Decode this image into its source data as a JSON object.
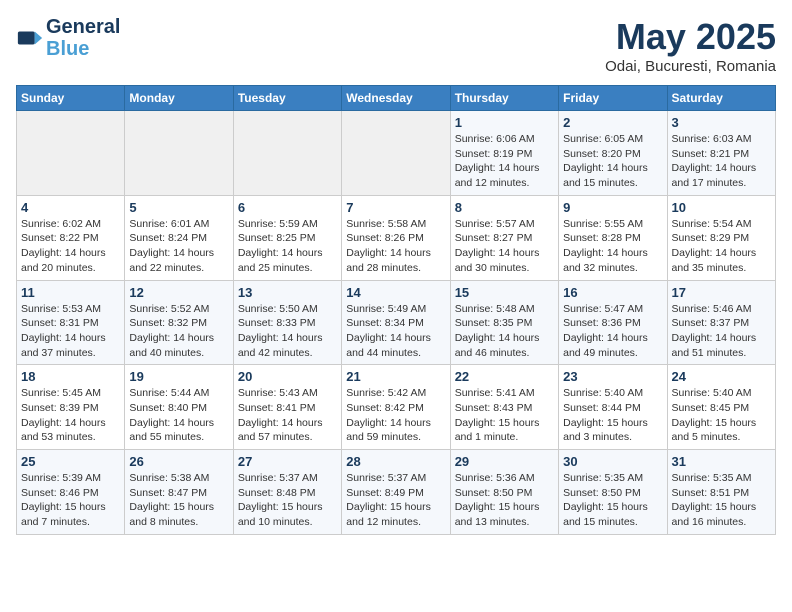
{
  "header": {
    "logo_line1": "General",
    "logo_line2": "Blue",
    "month_title": "May 2025",
    "subtitle": "Odai, Bucuresti, Romania"
  },
  "weekdays": [
    "Sunday",
    "Monday",
    "Tuesday",
    "Wednesday",
    "Thursday",
    "Friday",
    "Saturday"
  ],
  "weeks": [
    [
      {
        "day": "",
        "info": ""
      },
      {
        "day": "",
        "info": ""
      },
      {
        "day": "",
        "info": ""
      },
      {
        "day": "",
        "info": ""
      },
      {
        "day": "1",
        "info": "Sunrise: 6:06 AM\nSunset: 8:19 PM\nDaylight: 14 hours\nand 12 minutes."
      },
      {
        "day": "2",
        "info": "Sunrise: 6:05 AM\nSunset: 8:20 PM\nDaylight: 14 hours\nand 15 minutes."
      },
      {
        "day": "3",
        "info": "Sunrise: 6:03 AM\nSunset: 8:21 PM\nDaylight: 14 hours\nand 17 minutes."
      }
    ],
    [
      {
        "day": "4",
        "info": "Sunrise: 6:02 AM\nSunset: 8:22 PM\nDaylight: 14 hours\nand 20 minutes."
      },
      {
        "day": "5",
        "info": "Sunrise: 6:01 AM\nSunset: 8:24 PM\nDaylight: 14 hours\nand 22 minutes."
      },
      {
        "day": "6",
        "info": "Sunrise: 5:59 AM\nSunset: 8:25 PM\nDaylight: 14 hours\nand 25 minutes."
      },
      {
        "day": "7",
        "info": "Sunrise: 5:58 AM\nSunset: 8:26 PM\nDaylight: 14 hours\nand 28 minutes."
      },
      {
        "day": "8",
        "info": "Sunrise: 5:57 AM\nSunset: 8:27 PM\nDaylight: 14 hours\nand 30 minutes."
      },
      {
        "day": "9",
        "info": "Sunrise: 5:55 AM\nSunset: 8:28 PM\nDaylight: 14 hours\nand 32 minutes."
      },
      {
        "day": "10",
        "info": "Sunrise: 5:54 AM\nSunset: 8:29 PM\nDaylight: 14 hours\nand 35 minutes."
      }
    ],
    [
      {
        "day": "11",
        "info": "Sunrise: 5:53 AM\nSunset: 8:31 PM\nDaylight: 14 hours\nand 37 minutes."
      },
      {
        "day": "12",
        "info": "Sunrise: 5:52 AM\nSunset: 8:32 PM\nDaylight: 14 hours\nand 40 minutes."
      },
      {
        "day": "13",
        "info": "Sunrise: 5:50 AM\nSunset: 8:33 PM\nDaylight: 14 hours\nand 42 minutes."
      },
      {
        "day": "14",
        "info": "Sunrise: 5:49 AM\nSunset: 8:34 PM\nDaylight: 14 hours\nand 44 minutes."
      },
      {
        "day": "15",
        "info": "Sunrise: 5:48 AM\nSunset: 8:35 PM\nDaylight: 14 hours\nand 46 minutes."
      },
      {
        "day": "16",
        "info": "Sunrise: 5:47 AM\nSunset: 8:36 PM\nDaylight: 14 hours\nand 49 minutes."
      },
      {
        "day": "17",
        "info": "Sunrise: 5:46 AM\nSunset: 8:37 PM\nDaylight: 14 hours\nand 51 minutes."
      }
    ],
    [
      {
        "day": "18",
        "info": "Sunrise: 5:45 AM\nSunset: 8:39 PM\nDaylight: 14 hours\nand 53 minutes."
      },
      {
        "day": "19",
        "info": "Sunrise: 5:44 AM\nSunset: 8:40 PM\nDaylight: 14 hours\nand 55 minutes."
      },
      {
        "day": "20",
        "info": "Sunrise: 5:43 AM\nSunset: 8:41 PM\nDaylight: 14 hours\nand 57 minutes."
      },
      {
        "day": "21",
        "info": "Sunrise: 5:42 AM\nSunset: 8:42 PM\nDaylight: 14 hours\nand 59 minutes."
      },
      {
        "day": "22",
        "info": "Sunrise: 5:41 AM\nSunset: 8:43 PM\nDaylight: 15 hours\nand 1 minute."
      },
      {
        "day": "23",
        "info": "Sunrise: 5:40 AM\nSunset: 8:44 PM\nDaylight: 15 hours\nand 3 minutes."
      },
      {
        "day": "24",
        "info": "Sunrise: 5:40 AM\nSunset: 8:45 PM\nDaylight: 15 hours\nand 5 minutes."
      }
    ],
    [
      {
        "day": "25",
        "info": "Sunrise: 5:39 AM\nSunset: 8:46 PM\nDaylight: 15 hours\nand 7 minutes."
      },
      {
        "day": "26",
        "info": "Sunrise: 5:38 AM\nSunset: 8:47 PM\nDaylight: 15 hours\nand 8 minutes."
      },
      {
        "day": "27",
        "info": "Sunrise: 5:37 AM\nSunset: 8:48 PM\nDaylight: 15 hours\nand 10 minutes."
      },
      {
        "day": "28",
        "info": "Sunrise: 5:37 AM\nSunset: 8:49 PM\nDaylight: 15 hours\nand 12 minutes."
      },
      {
        "day": "29",
        "info": "Sunrise: 5:36 AM\nSunset: 8:50 PM\nDaylight: 15 hours\nand 13 minutes."
      },
      {
        "day": "30",
        "info": "Sunrise: 5:35 AM\nSunset: 8:50 PM\nDaylight: 15 hours\nand 15 minutes."
      },
      {
        "day": "31",
        "info": "Sunrise: 5:35 AM\nSunset: 8:51 PM\nDaylight: 15 hours\nand 16 minutes."
      }
    ]
  ]
}
